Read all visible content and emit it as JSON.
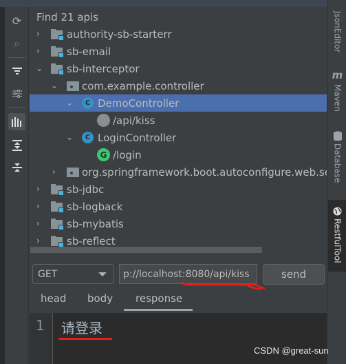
{
  "tree": {
    "header": "Find 21 apis",
    "rows": [
      {
        "label": "authority-sb-starterr",
        "type": "module",
        "expanded": false
      },
      {
        "label": "sb-email",
        "type": "module",
        "expanded": false
      },
      {
        "label": "sb-interceptor",
        "type": "module",
        "expanded": true
      },
      {
        "label": "com.example.controller",
        "type": "package",
        "expanded": true
      },
      {
        "label": "DemoController",
        "type": "class",
        "expanded": true,
        "selected": true
      },
      {
        "label": "/api/kiss",
        "type": "method",
        "method_badge": ""
      },
      {
        "label": "LoginController",
        "type": "class",
        "expanded": true
      },
      {
        "label": "/login",
        "type": "method",
        "method_badge": "G"
      },
      {
        "label": "org.springframework.boot.autoconfigure.web.se",
        "type": "package",
        "expanded": false
      },
      {
        "label": "sb-jdbc",
        "type": "module",
        "expanded": false
      },
      {
        "label": "sb-logback",
        "type": "module",
        "expanded": false
      },
      {
        "label": "sb-mybatis",
        "type": "module",
        "expanded": false
      },
      {
        "label": "sb-reflect",
        "type": "module",
        "expanded": false
      }
    ],
    "class_badge": "C"
  },
  "toolbar_icons": [
    "refresh-icon",
    "search-icon",
    "filter-icon",
    "settings-sliders-icon",
    "chart-icon",
    "expand-all-icon",
    "collapse-all-icon"
  ],
  "request": {
    "method": "GET",
    "url": "p://localhost:8080/api/kiss",
    "send_label": "send"
  },
  "tabs": [
    {
      "label": "head"
    },
    {
      "label": "body"
    },
    {
      "label": "response",
      "active": true
    }
  ],
  "editor": {
    "line_number": "1",
    "content": "请登录"
  },
  "right_sidebar": [
    {
      "label": "JsonEditor",
      "icon": "json-icon"
    },
    {
      "label": "Maven",
      "icon": "maven-icon",
      "glyph": "m"
    },
    {
      "label": "Database",
      "icon": "database-icon"
    },
    {
      "label": "RestfulTool",
      "icon": "globe-icon",
      "active": true
    }
  ],
  "watermark": "CSDN @great-sun",
  "colors": {
    "selection": "#4b6eaf",
    "class_icon": "#3592c4",
    "get_badge": "#3cc773",
    "annotation": "#e3201b"
  }
}
